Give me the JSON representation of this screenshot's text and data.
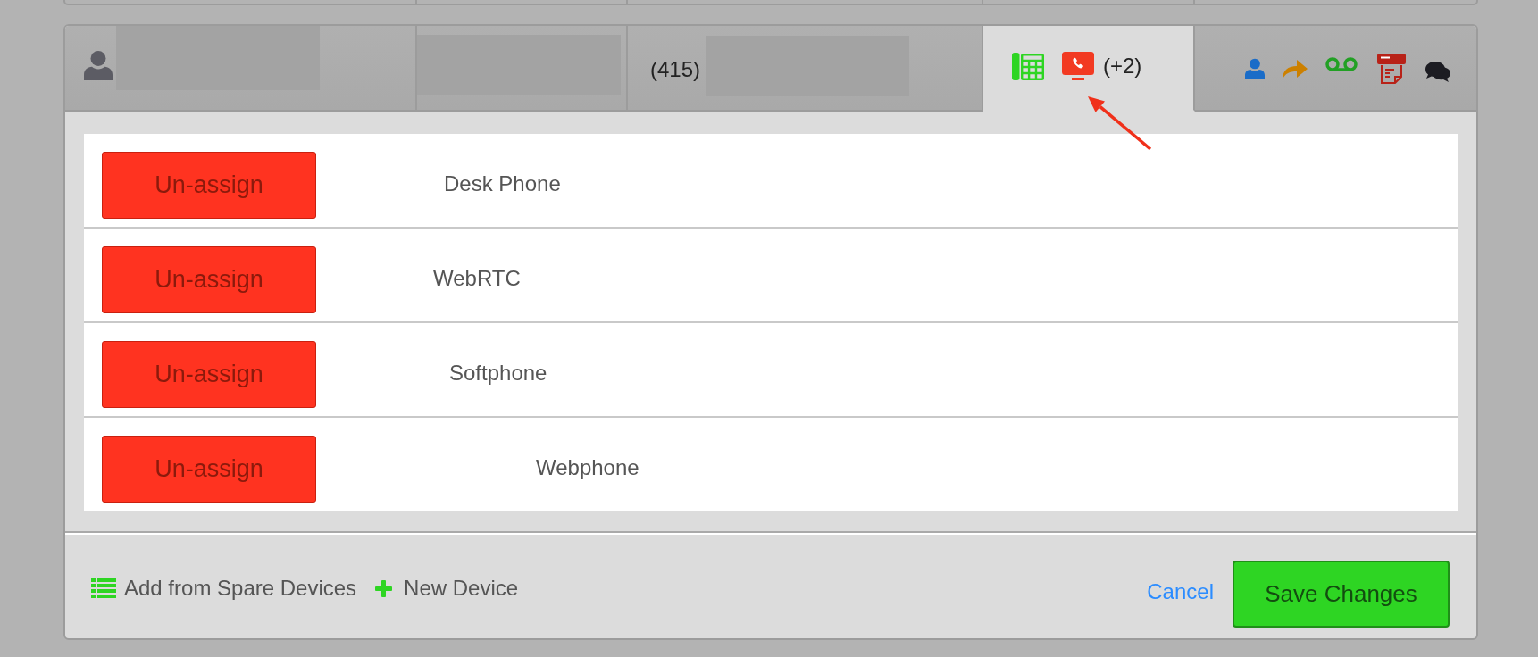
{
  "tabs": [
    {
      "kind": "person",
      "redacted": true,
      "selected": false
    },
    {
      "kind": "plain",
      "redacted": true,
      "selected": false
    },
    {
      "kind": "number",
      "text": "(415)",
      "redacted": true,
      "selected": false
    },
    {
      "kind": "devices",
      "text": "(+2)",
      "redacted": false,
      "selected": true
    },
    {
      "kind": "features",
      "redacted": false,
      "selected": false
    }
  ],
  "annotations": [
    {
      "kind": "arrow"
    }
  ],
  "devices": [
    {
      "name": "Desk Phone",
      "button": "Un-assign"
    },
    {
      "name": "WebRTC",
      "button": "Un-assign"
    },
    {
      "name": "Softphone",
      "button": "Un-assign"
    },
    {
      "name": "Webphone",
      "button": "Un-assign"
    }
  ],
  "footer": {
    "actions": [
      {
        "kind": "list",
        "label": "Add from Spare Devices"
      },
      {
        "kind": "add",
        "label": "New Device"
      }
    ],
    "cancel": "Cancel",
    "save": "Save Changes"
  }
}
